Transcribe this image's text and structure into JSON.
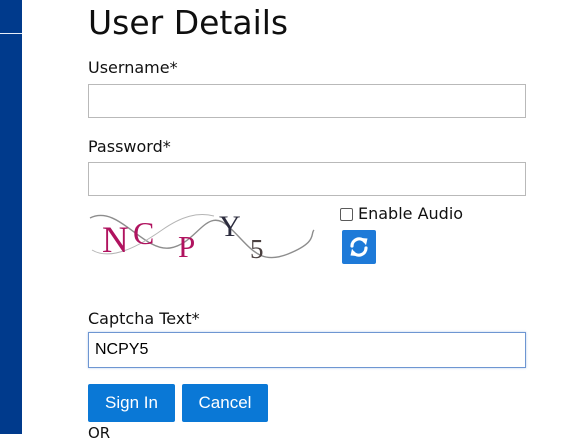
{
  "page": {
    "title": "User Details"
  },
  "form": {
    "username": {
      "label": "Username*",
      "value": "",
      "placeholder": ""
    },
    "password": {
      "label": "Password*",
      "value": "",
      "placeholder": ""
    },
    "captcha": {
      "image_text": "NCPY5",
      "enable_audio_label": "Enable Audio",
      "enable_audio_checked": false,
      "refresh_icon": "refresh-icon",
      "label": "Captcha Text*",
      "value": "NCPY5"
    },
    "buttons": {
      "sign_in": "Sign In",
      "cancel": "Cancel"
    },
    "divider_text": "OR"
  },
  "colors": {
    "sidebar": "#003a8c",
    "button": "#0a78d6",
    "refresh_button": "#1e7ad8",
    "captcha_letters": "#b0135f"
  }
}
